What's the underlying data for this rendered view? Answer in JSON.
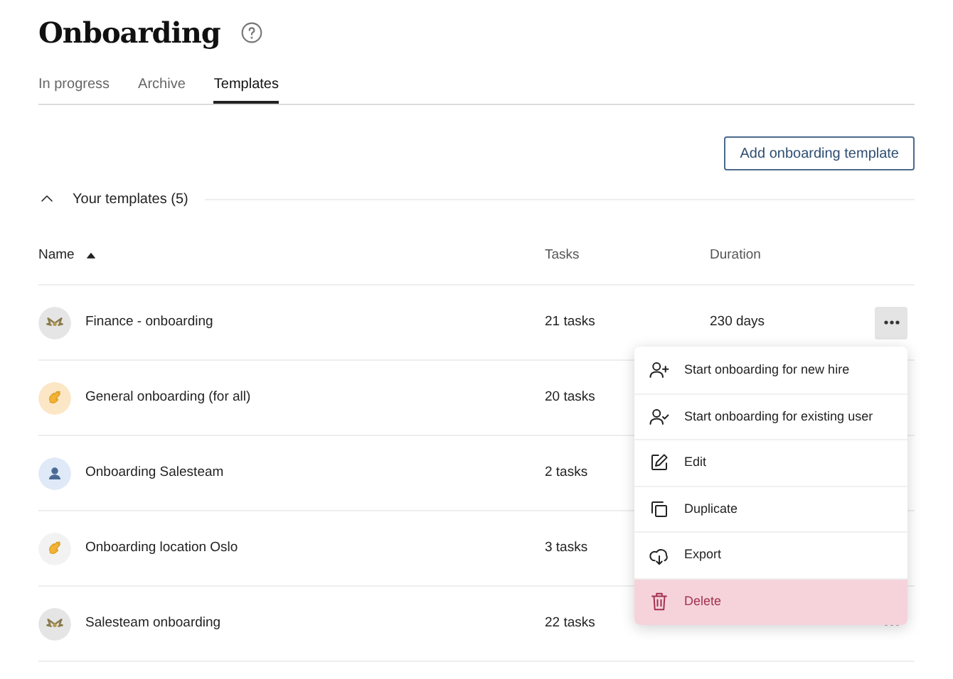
{
  "page": {
    "title": "Onboarding"
  },
  "tabs": [
    {
      "label": "In progress",
      "selected": false
    },
    {
      "label": "Archive",
      "selected": false
    },
    {
      "label": "Templates",
      "selected": true
    }
  ],
  "add_button": "Add onboarding template",
  "section": {
    "title": "Your templates (5)",
    "expanded": true
  },
  "table": {
    "columns": [
      {
        "label": "Name",
        "sort_ascending": true
      },
      {
        "label": "Tasks"
      },
      {
        "label": "Duration"
      }
    ],
    "rows": [
      {
        "kind": "wings",
        "color": "#e5e5e5",
        "name": "Finance - onboarding",
        "tasks": "21 tasks",
        "duration": "230 days",
        "more_button": {
          "selected": true
        }
      },
      {
        "kind": "wave",
        "color": "#fbe6c6",
        "name": "General onboarding (for all)",
        "tasks": "20 tasks"
      },
      {
        "kind": "person",
        "color": "#dfe9f7",
        "name": "Onboarding Salesteam",
        "tasks": "2 tasks"
      },
      {
        "kind": "wave",
        "color": "#f2f2f2",
        "name": "Onboarding location Oslo",
        "tasks": "3 tasks"
      },
      {
        "kind": "wings",
        "color": "#e5e5e5",
        "name": "Salesteam onboarding",
        "tasks": "22 tasks",
        "more_button": {
          "selected": false
        }
      }
    ]
  },
  "menu": {
    "items": [
      {
        "kind": "person-add",
        "label": "Start onboarding for new hire",
        "danger": false
      },
      {
        "kind": "person-check",
        "label": "Start onboarding for existing user",
        "danger": false
      },
      {
        "kind": "edit",
        "label": "Edit",
        "danger": false
      },
      {
        "kind": "duplicate",
        "label": "Duplicate",
        "danger": false
      },
      {
        "kind": "export",
        "label": "Export",
        "danger": false
      },
      {
        "kind": "trash",
        "label": "Delete",
        "danger": true
      }
    ]
  }
}
